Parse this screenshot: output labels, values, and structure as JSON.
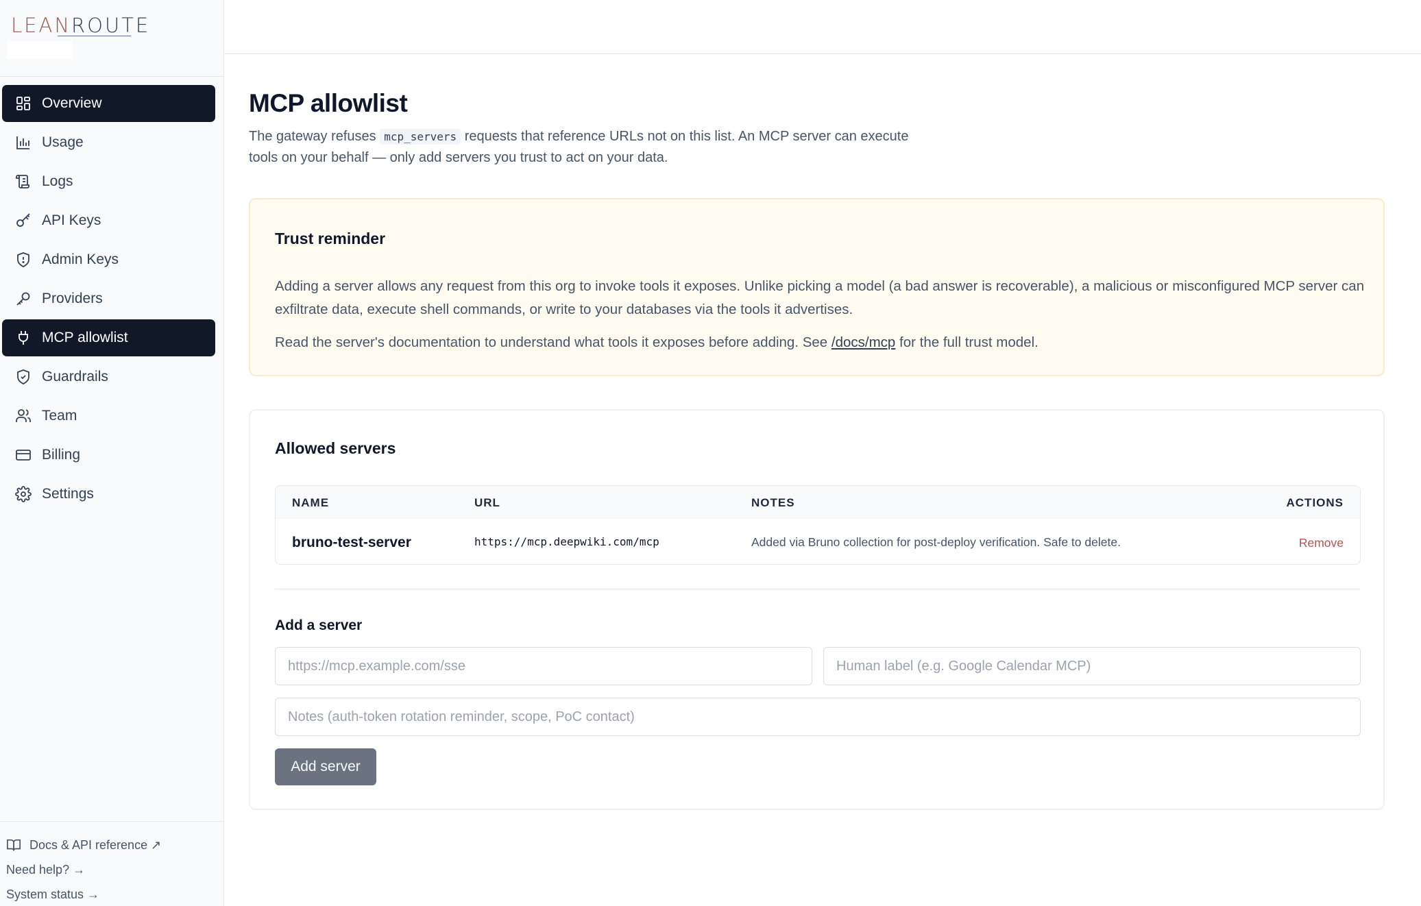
{
  "brand": {
    "logo_text_a": "LEAN",
    "logo_text_b": "ROUTE"
  },
  "sidebar": {
    "items": [
      {
        "label": "Overview",
        "icon": "grid-icon"
      },
      {
        "label": "Usage",
        "icon": "bar-chart-icon"
      },
      {
        "label": "Logs",
        "icon": "scroll-icon"
      },
      {
        "label": "API Keys",
        "icon": "key-icon"
      },
      {
        "label": "Admin Keys",
        "icon": "shield-icon"
      },
      {
        "label": "Providers",
        "icon": "wrench-key-icon"
      },
      {
        "label": "MCP allowlist",
        "icon": "plug-icon"
      },
      {
        "label": "Guardrails",
        "icon": "shield-check-icon"
      },
      {
        "label": "Team",
        "icon": "users-icon"
      },
      {
        "label": "Billing",
        "icon": "credit-card-icon"
      },
      {
        "label": "Settings",
        "icon": "gear-icon"
      }
    ],
    "active_items": [
      "Overview",
      "MCP allowlist"
    ],
    "footer": {
      "docs": "Docs & API reference ↗",
      "help": "Need help? →",
      "status": "System status →"
    }
  },
  "page": {
    "title": "MCP allowlist",
    "desc_before": "The gateway refuses ",
    "desc_code": "mcp_servers",
    "desc_after": " requests that reference URLs not on this list. An MCP server can execute tools on your behalf — only add servers you trust to act on your data."
  },
  "trust": {
    "title": "Trust reminder",
    "p1": "Adding a server allows any request from this org to invoke tools it exposes. Unlike picking a model (a bad answer is recoverable), a malicious or misconfigured MCP server can exfiltrate data, execute shell commands, or write to your databases via the tools it advertises.",
    "p2_before": "Read the server's documentation to understand what tools it exposes before adding. See ",
    "p2_link": "/docs/mcp",
    "p2_after": " for the full trust model."
  },
  "servers": {
    "title": "Allowed servers",
    "columns": {
      "name": "NAME",
      "url": "URL",
      "notes": "NOTES",
      "actions": "ACTIONS"
    },
    "rows": [
      {
        "name": "bruno-test-server",
        "url": "https://mcp.deepwiki.com/mcp",
        "notes": "Added via Bruno collection for post-deploy verification. Safe to delete.",
        "action": "Remove"
      }
    ]
  },
  "add": {
    "title": "Add a server",
    "url_placeholder": "https://mcp.example.com/sse",
    "label_placeholder": "Human label (e.g. Google Calendar MCP)",
    "notes_placeholder": "Notes (auth-token rotation reminder, scope, PoC contact)",
    "button": "Add server"
  },
  "colors": {
    "active_nav": "#111827",
    "trust_bg": "#fffbf0",
    "remove": "#b45353",
    "button_disabled": "#6b7280"
  }
}
